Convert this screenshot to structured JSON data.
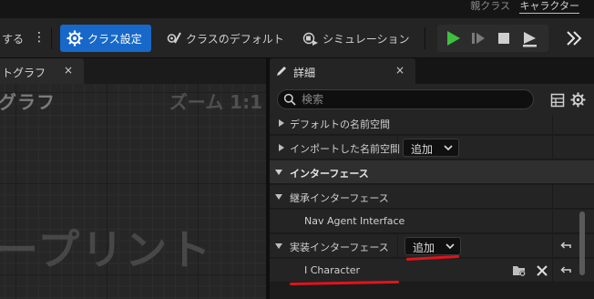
{
  "top_bar": {
    "parent_class_label": "親クラス",
    "parent_class_value": "キャラクター"
  },
  "toolbar": {
    "left_cut_label": "する",
    "class_settings_label": "クラス設定",
    "class_defaults_label": "クラスのデフォルト",
    "simulation_label": "シミュレーション",
    "accent_color": "#1768c8",
    "play_color": "#3fbf3f"
  },
  "graph_panel": {
    "tab_label": "トグラフ",
    "close_label": "×",
    "title": "グラフ",
    "zoom_label": "ズーム 1:1",
    "watermark": "ープリント"
  },
  "details_panel": {
    "tab_label": "詳細",
    "close_label": "×",
    "search_placeholder": "検索",
    "rows": [
      {
        "label": "デフォルトの名前空間"
      },
      {
        "label": "インポートした名前空間",
        "button": "追加"
      },
      {
        "label": "インターフェース"
      },
      {
        "label": "継承インターフェース"
      },
      {
        "label": "Nav Agent Interface"
      },
      {
        "label": "実装インターフェース",
        "button": "追加"
      },
      {
        "label": "I Character"
      }
    ]
  },
  "annotation": {
    "underline_color": "#e0141c"
  }
}
